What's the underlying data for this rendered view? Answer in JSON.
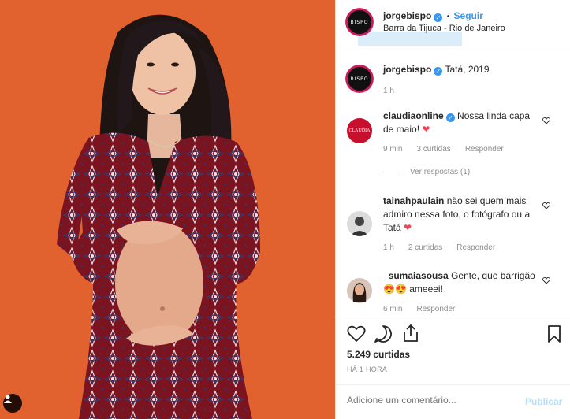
{
  "post": {
    "author": "jorgebispo",
    "follow_label": "Seguir",
    "dot": "•",
    "location": "Barra da Tijuca - Rio de Janeiro",
    "logo_text": "BISPO",
    "caption": "Tatá, 2019",
    "caption_time": "1 h"
  },
  "comments": [
    {
      "user": "claudiaonline",
      "verified": true,
      "avatar_text": "CLAUDIA",
      "text": "Nossa linda capa de maio!",
      "time": "9 min",
      "likes": "3 curtidas",
      "reply": "Responder",
      "view_replies": "Ver respostas (1)"
    },
    {
      "user": "tainahpaulain",
      "text": "não sei quem mais admiro nessa foto, o fotógrafo ou a Tatá",
      "time": "1 h",
      "likes": "2 curtidas",
      "reply": "Responder"
    },
    {
      "user": "_sumaiasousa",
      "text": "Gente, que barrigão",
      "text_end": "ameeei!",
      "time": "6 min",
      "reply": "Responder"
    }
  ],
  "footer": {
    "likes": "5.249 curtidas",
    "time_ago": "HÁ 1 HORA",
    "comment_placeholder": "Adicione um comentário...",
    "publish_label": "Publicar"
  },
  "colors": {
    "photo_bg": "#e2622f",
    "dress": "#7a1420",
    "link_blue": "#3897f0",
    "heart_red": "#ed4956"
  },
  "icons": [
    "heart-icon",
    "comment-icon",
    "share-icon",
    "bookmark-icon",
    "verified-icon",
    "user-tag-icon"
  ]
}
